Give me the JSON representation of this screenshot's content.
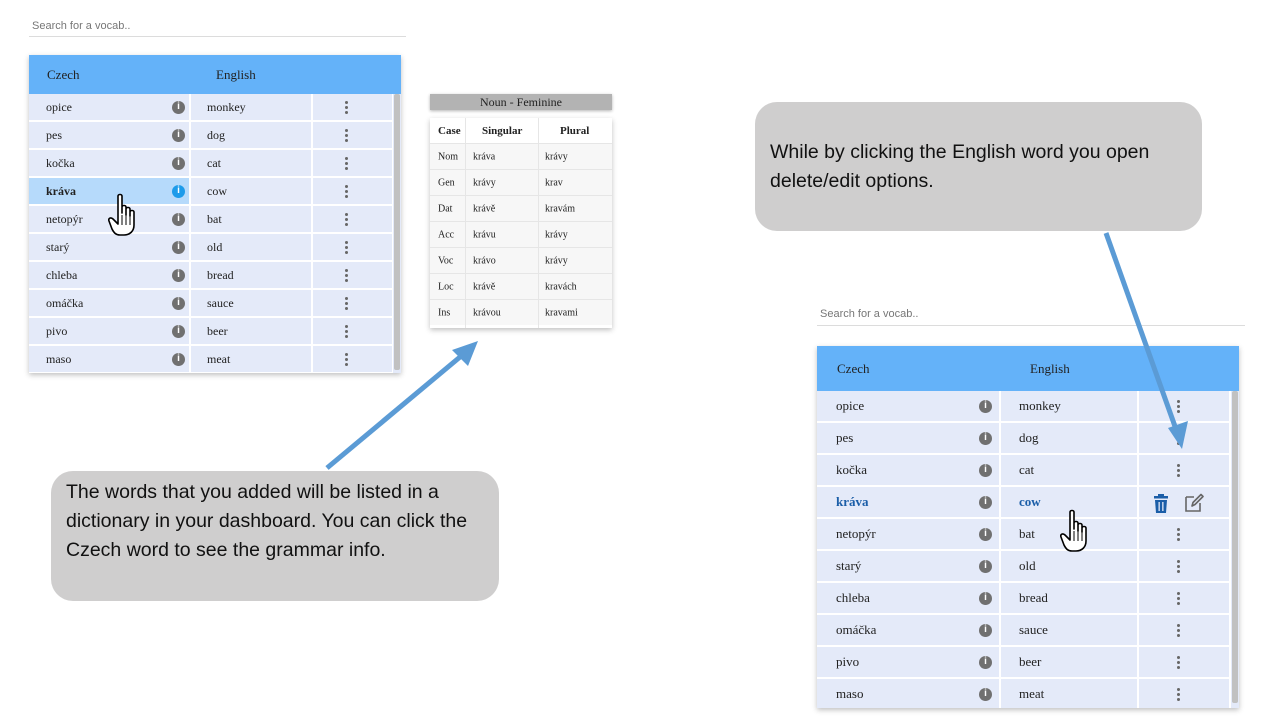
{
  "left_panel": {
    "search_placeholder": "Search for a vocab..",
    "header": {
      "czech": "Czech",
      "english": "English"
    },
    "rows": [
      {
        "czech": "opice",
        "english": "monkey"
      },
      {
        "czech": "pes",
        "english": "dog"
      },
      {
        "czech": "kočka",
        "english": "cat"
      },
      {
        "czech": "kráva",
        "english": "cow"
      },
      {
        "czech": "netopýr",
        "english": "bat"
      },
      {
        "czech": "starý",
        "english": "old"
      },
      {
        "czech": "chleba",
        "english": "bread"
      },
      {
        "czech": "omáčka",
        "english": "sauce"
      },
      {
        "czech": "pivo",
        "english": "beer"
      },
      {
        "czech": "maso",
        "english": "meat"
      }
    ]
  },
  "grammar_popup": {
    "title": "Noun - Feminine",
    "headers": {
      "case": "Case",
      "singular": "Singular",
      "plural": "Plural"
    },
    "rows": [
      {
        "case": "Nom",
        "singular": "kráva",
        "plural": "krávy"
      },
      {
        "case": "Gen",
        "singular": "krávy",
        "plural": "krav"
      },
      {
        "case": "Dat",
        "singular": "krávě",
        "plural": "kravám"
      },
      {
        "case": "Acc",
        "singular": "krávu",
        "plural": "krávy"
      },
      {
        "case": "Voc",
        "singular": "krávo",
        "plural": "krávy"
      },
      {
        "case": "Loc",
        "singular": "krávě",
        "plural": "kravách"
      },
      {
        "case": "Ins",
        "singular": "krávou",
        "plural": "kravami"
      }
    ]
  },
  "right_panel": {
    "search_placeholder": "Search for a vocab..",
    "header": {
      "czech": "Czech",
      "english": "English"
    },
    "rows": [
      {
        "czech": "opice",
        "english": "monkey"
      },
      {
        "czech": "pes",
        "english": "dog"
      },
      {
        "czech": "kočka",
        "english": "cat"
      },
      {
        "czech": "kráva",
        "english": "cow"
      },
      {
        "czech": "netopýr",
        "english": "bat"
      },
      {
        "czech": "starý",
        "english": "old"
      },
      {
        "czech": "chleba",
        "english": "bread"
      },
      {
        "czech": "omáčka",
        "english": "sauce"
      },
      {
        "czech": "pivo",
        "english": "beer"
      },
      {
        "czech": "maso",
        "english": "meat"
      }
    ]
  },
  "callouts": {
    "left": "The words that you added will be listed in a dictionary in your dashboard. You can click the Czech word to see the grammar info.",
    "right": "While by clicking the English word you open delete/edit options."
  },
  "icons": {
    "info": "info-icon",
    "menu": "kebab-menu-icon",
    "delete": "trash-icon",
    "edit": "edit-icon",
    "cursor": "hand-pointer-cursor"
  },
  "colors": {
    "header": "#64b2f9",
    "row": "#e4eaf9",
    "selected_row": "#b6dafb",
    "callout": "#cfcece",
    "arrow": "#5b9bd5",
    "action_blue": "#1b5ea8"
  }
}
